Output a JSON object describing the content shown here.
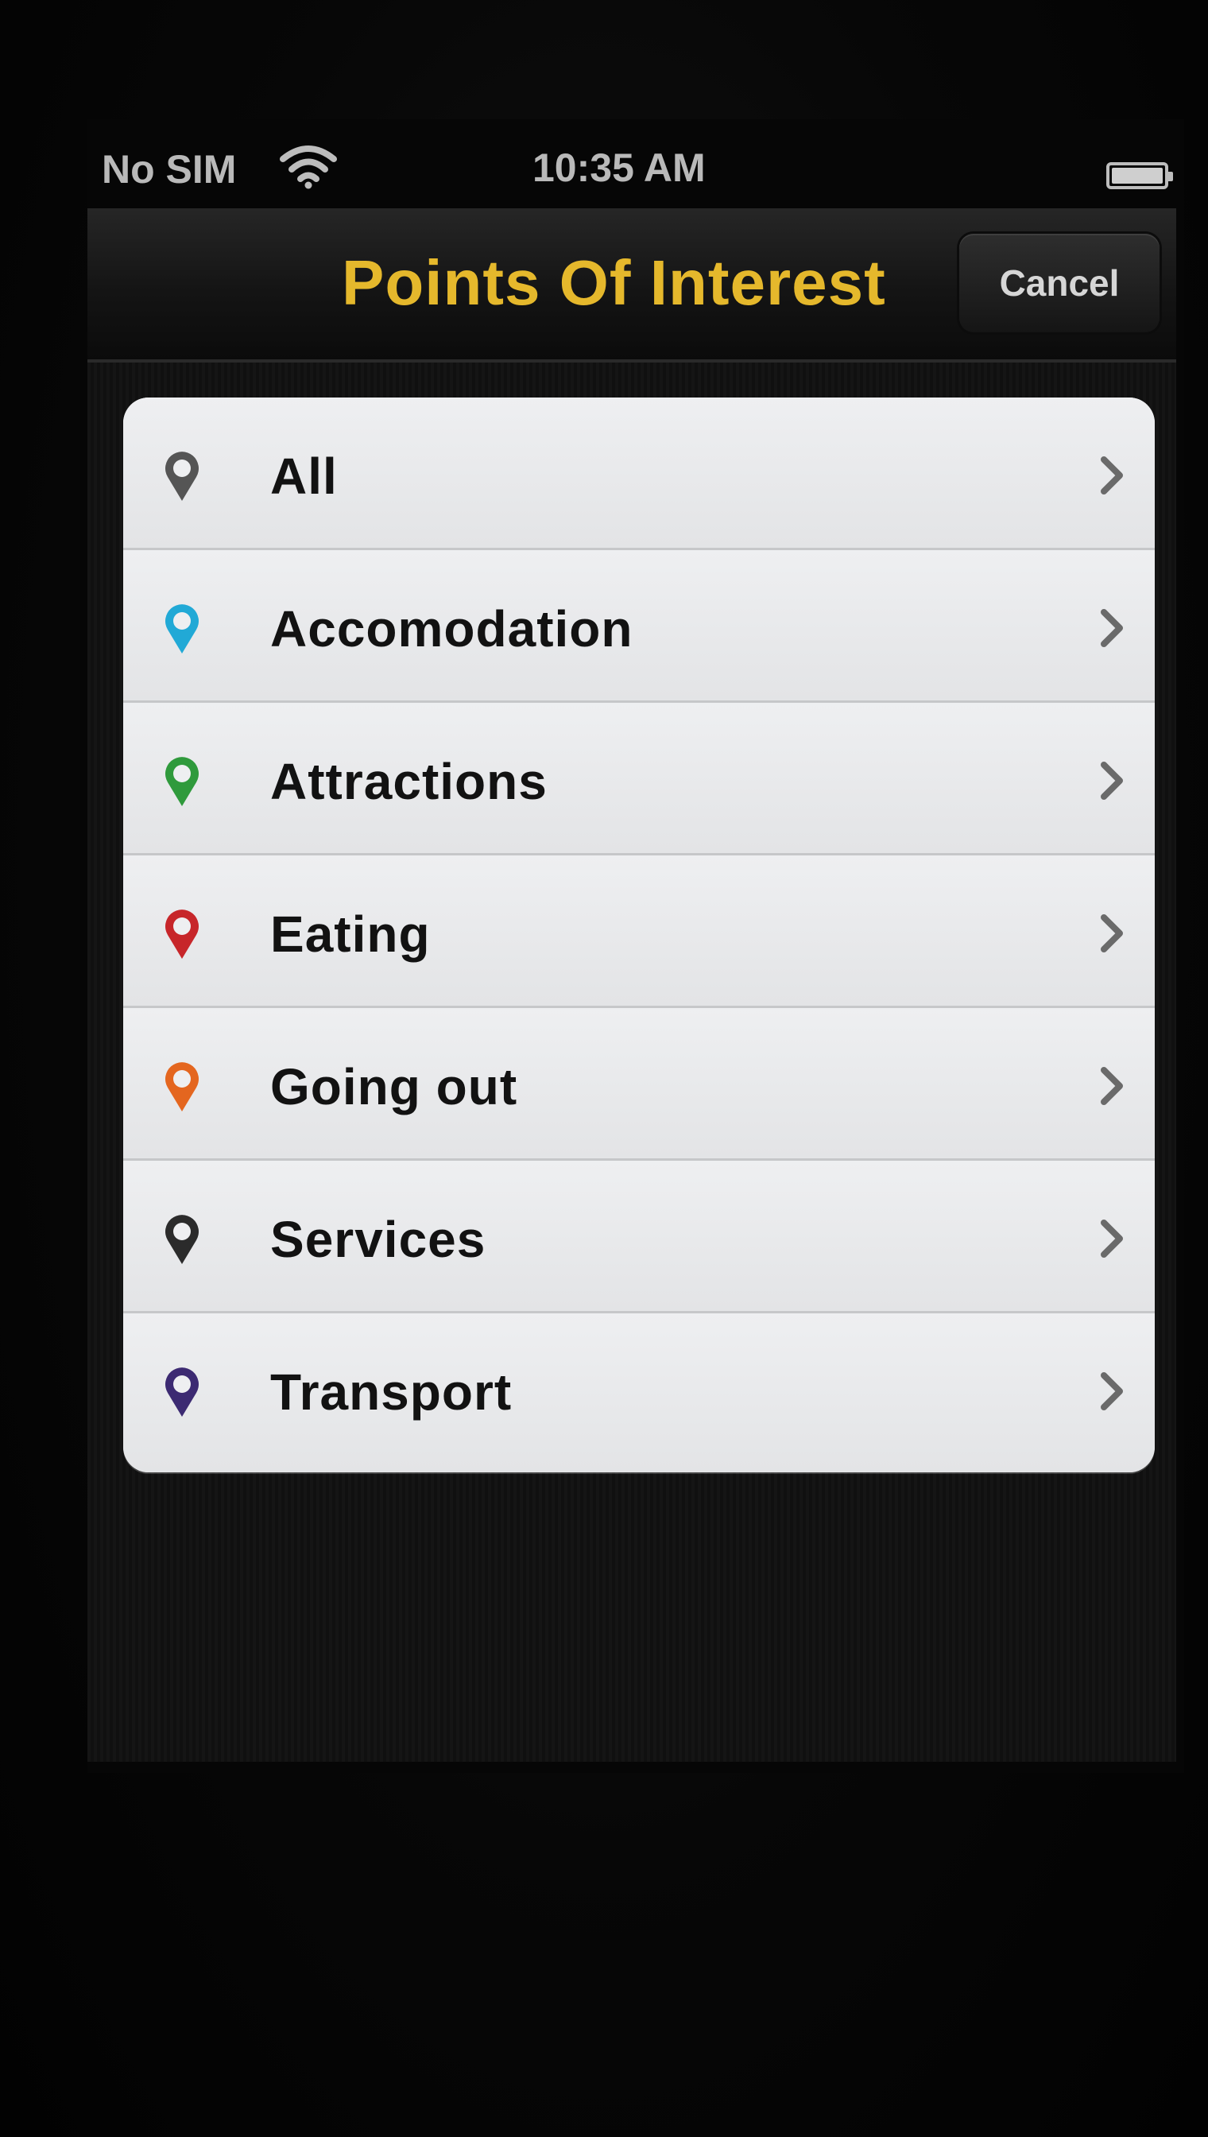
{
  "status_bar": {
    "carrier": "No SIM",
    "time": "10:35 AM"
  },
  "nav": {
    "title": "Points Of Interest",
    "cancel_label": "Cancel",
    "title_color": "#e5b82c"
  },
  "categories": [
    {
      "label": "All",
      "icon": "map-pin-icon",
      "color": "#555555"
    },
    {
      "label": "Accomodation",
      "icon": "map-pin-icon",
      "color": "#21a9d6"
    },
    {
      "label": "Attractions",
      "icon": "map-pin-icon",
      "color": "#2f9a3c"
    },
    {
      "label": "Eating",
      "icon": "map-pin-icon",
      "color": "#c7262a"
    },
    {
      "label": "Going out",
      "icon": "map-pin-icon",
      "color": "#e4661f"
    },
    {
      "label": "Services",
      "icon": "map-pin-icon",
      "color": "#2b2b2b"
    },
    {
      "label": "Transport",
      "icon": "map-pin-icon",
      "color": "#3c2a72"
    }
  ]
}
